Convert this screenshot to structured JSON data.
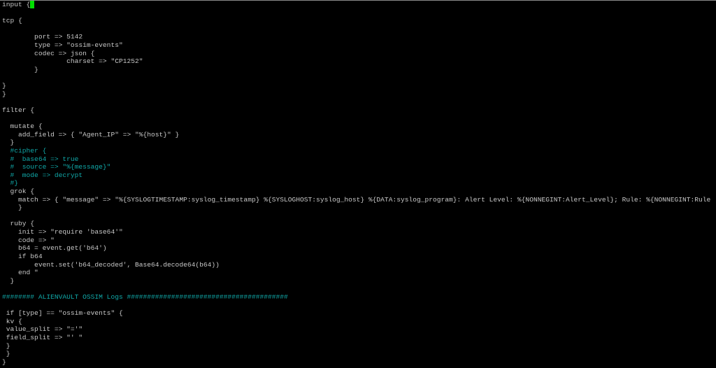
{
  "editor": {
    "colors": {
      "text": "#c8c8c8",
      "comment": "#10a8a8",
      "cursor": "#00e000",
      "background": "#000000"
    },
    "lines": [
      {
        "t": "input {",
        "c": false,
        "cursor": true
      },
      {
        "t": "",
        "c": false
      },
      {
        "t": "tcp {",
        "c": false
      },
      {
        "t": "",
        "c": false
      },
      {
        "t": "        port => 5142",
        "c": false
      },
      {
        "t": "        type => \"ossim-events\"",
        "c": false
      },
      {
        "t": "        codec => json {",
        "c": false
      },
      {
        "t": "                charset => \"CP1252\"",
        "c": false
      },
      {
        "t": "        }",
        "c": false
      },
      {
        "t": "",
        "c": false
      },
      {
        "t": "}",
        "c": false
      },
      {
        "t": "}",
        "c": false
      },
      {
        "t": "",
        "c": false
      },
      {
        "t": "filter {",
        "c": false
      },
      {
        "t": "",
        "c": false
      },
      {
        "t": "  mutate {",
        "c": false
      },
      {
        "t": "    add_field => { \"Agent_IP\" => \"%{host}\" }",
        "c": false
      },
      {
        "t": "  }",
        "c": false
      },
      {
        "t": "  #cipher {",
        "c": true
      },
      {
        "t": "  #  base64 => true",
        "c": true
      },
      {
        "t": "  #  source => \"%{message}\"",
        "c": true
      },
      {
        "t": "  #  mode => decrypt",
        "c": true
      },
      {
        "t": "  #}",
        "c": true
      },
      {
        "t": "  grok {",
        "c": false
      },
      {
        "t": "    match => { \"message\" => \"%{SYSLOGTIMESTAMP:syslog_timestamp} %{SYSLOGHOST:syslog_host} %{DATA:syslog_program}: Alert Level: %{NONNEGINT:Alert_Level}; Rule: %{NONNEGINT:Rule",
        "c": false
      },
      {
        "t": "    }",
        "c": false
      },
      {
        "t": "",
        "c": false
      },
      {
        "t": "  ruby {",
        "c": false
      },
      {
        "t": "    init => \"require 'base64'\"",
        "c": false
      },
      {
        "t": "    code => \"",
        "c": false
      },
      {
        "t": "    b64 = event.get('b64')",
        "c": false
      },
      {
        "t": "    if b64",
        "c": false
      },
      {
        "t": "        event.set('b64_decoded', Base64.decode64(b64))",
        "c": false
      },
      {
        "t": "    end \"",
        "c": false
      },
      {
        "t": "  }",
        "c": false
      },
      {
        "t": "",
        "c": false
      },
      {
        "t": "######## ALIENVAULT OSSIM Logs ########################################",
        "c": true
      },
      {
        "t": "",
        "c": false
      },
      {
        "t": " if [type] == \"ossim-events\" {",
        "c": false
      },
      {
        "t": " kv {",
        "c": false
      },
      {
        "t": " value_split => \"='\"",
        "c": false
      },
      {
        "t": " field_split => \"' \"",
        "c": false
      },
      {
        "t": " }",
        "c": false
      },
      {
        "t": " }",
        "c": false
      },
      {
        "t": "}",
        "c": false
      }
    ]
  }
}
